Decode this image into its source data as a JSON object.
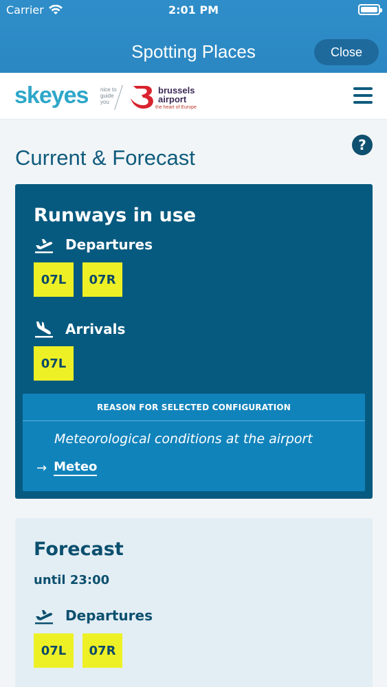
{
  "status_bar": {
    "carrier": "Carrier",
    "time": "2:01 PM"
  },
  "nav": {
    "title": "Spotting Places",
    "close_label": "Close"
  },
  "header": {
    "brand_primary": "skeyes",
    "brand_tagline": [
      "nice to",
      "guide",
      "you"
    ],
    "brand_secondary_line1": "brussels",
    "brand_secondary_line2": "airport",
    "brand_secondary_sub": "the heart of Europe",
    "menu_icon": "hamburger-icon"
  },
  "page": {
    "title": "Current & Forecast",
    "help_symbol": "?"
  },
  "current": {
    "title": "Runways in use",
    "departures_label": "Departures",
    "departures": [
      "07L",
      "07R"
    ],
    "arrivals_label": "Arrivals",
    "arrivals": [
      "07L"
    ],
    "reason_heading": "REASON FOR SELECTED CONFIGURATION",
    "reason_text": "Meteorological conditions at the airport",
    "meteo_arrow": "→",
    "meteo_link": "Meteo"
  },
  "forecast": {
    "title": "Forecast",
    "until": "until 23:00",
    "departures_label": "Departures",
    "departures": [
      "07L",
      "07R"
    ]
  },
  "colors": {
    "top_blue": "#2b87c2",
    "card_blue": "#075a7f",
    "reason_blue": "#1183bb",
    "runway_yellow": "#eef026",
    "forecast_bg": "#e3eef4"
  }
}
